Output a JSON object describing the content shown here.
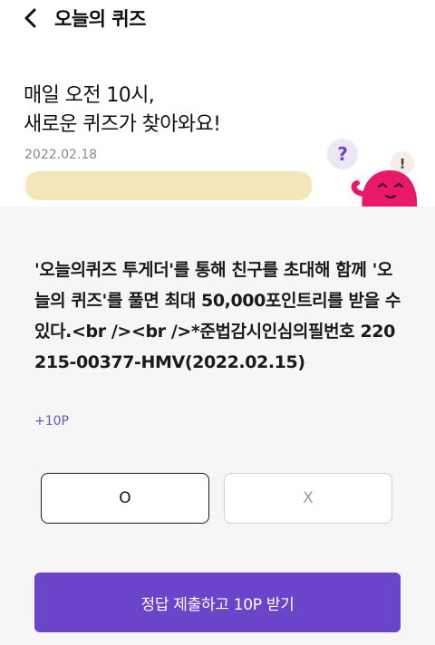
{
  "topbar": {
    "title": "오늘의 퀴즈"
  },
  "header": {
    "headline_line1": "매일 오전 10시,",
    "headline_line2": "새로운 퀴즈가 찾아와요!",
    "date": "2022.02.18",
    "mascot_symbols": [
      "?",
      "!"
    ]
  },
  "quiz": {
    "question": "'오늘의퀴즈 투게더'를 통해 친구를 초대해 함께 '오늘의 퀴즈'를 풀면 최대 50,000포인트리를 받을 수 있다.<br /><br />*준법감시인심의필번호 220215-00377-HMV(2022.02.15)",
    "points": "+10P",
    "options": [
      {
        "label": "O",
        "selected": true
      },
      {
        "label": "X",
        "selected": false
      }
    ],
    "submit_label": "정답 제출하고 10P 받기"
  },
  "colors": {
    "accent": "#6b45c9",
    "highlight": "#f0e3ad",
    "mascot": "#e8186b",
    "card_bg": "#f6f6f6"
  }
}
